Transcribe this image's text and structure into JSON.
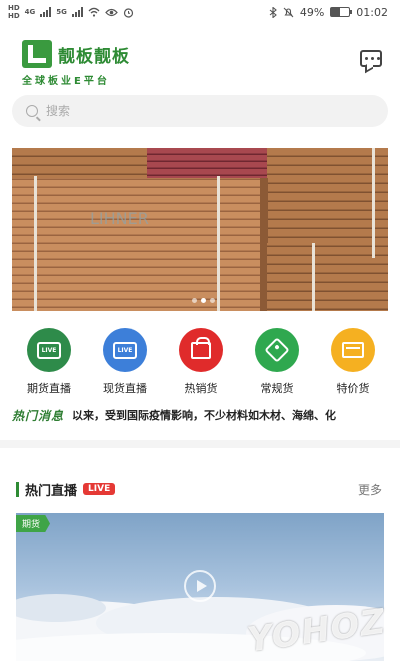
{
  "status_bar": {
    "battery": "49%",
    "time": "01:02",
    "battery_level": 0.49,
    "net_labels": [
      "HD",
      "4G",
      "5G"
    ]
  },
  "header": {
    "app_name": "靓板靓板",
    "slogan": "全球板业E平台",
    "message_icon": "message-icon"
  },
  "search": {
    "placeholder": "搜索"
  },
  "banner": {
    "carousel_total": 3,
    "carousel_active": 1,
    "print_text": "LIHNER"
  },
  "categories": [
    {
      "label": "期货直播",
      "icon": "live-tv-icon",
      "color": "#2e8b4a"
    },
    {
      "label": "现货直播",
      "icon": "live-camera-icon",
      "color": "#3d7fd9"
    },
    {
      "label": "热销货",
      "icon": "shopping-bag-icon",
      "color": "#e02b2b"
    },
    {
      "label": "常规货",
      "icon": "price-tag-icon",
      "color": "#2fa84f"
    },
    {
      "label": "特价货",
      "icon": "discount-box-icon",
      "color": "#f5b021"
    }
  ],
  "hot_news": {
    "label": "热门消息",
    "text": "以来，受到国际疫情影响，不少材料如木材、海绵、化"
  },
  "live_section": {
    "title": "热门直播",
    "badge": "LIVE",
    "more": "更多",
    "video_tag": "期货"
  },
  "watermark": "YOHOZ",
  "colors": {
    "brand_green": "#2e8b34",
    "live_red": "#e53935"
  }
}
